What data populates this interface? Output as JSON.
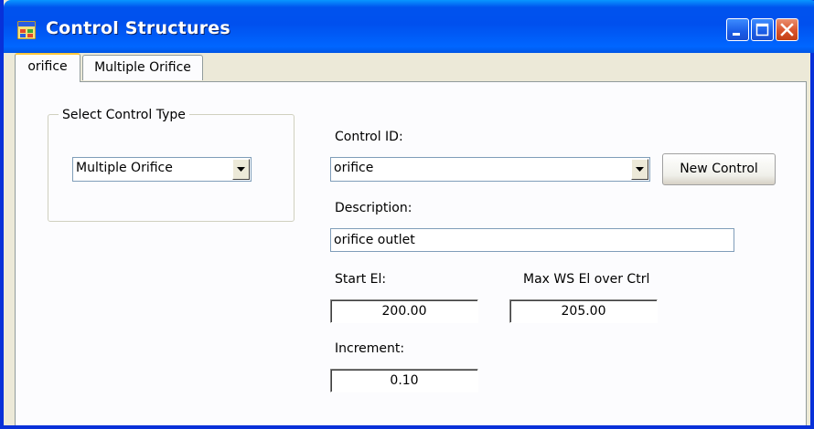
{
  "window": {
    "title": "Control Structures"
  },
  "tabs": [
    {
      "label": "orifice"
    },
    {
      "label": "Multiple Orifice"
    }
  ],
  "control_type": {
    "group_label": "Select Control Type",
    "selected": "Multiple Orifice"
  },
  "form": {
    "control_id_label": "Control ID:",
    "control_id_value": "orifice",
    "new_control_label": "New Control",
    "description_label": "Description:",
    "description_value": "orifice outlet",
    "start_el_label": "Start El:",
    "start_el_value": "200.00",
    "max_ws_label": "Max WS El over Ctrl",
    "max_ws_value": "205.00",
    "increment_label": "Increment:",
    "increment_value": "0.10"
  },
  "colors": {
    "title_bar": "#0054e3",
    "tab_highlight": "#ffc83c",
    "close_button": "#d9532b"
  }
}
